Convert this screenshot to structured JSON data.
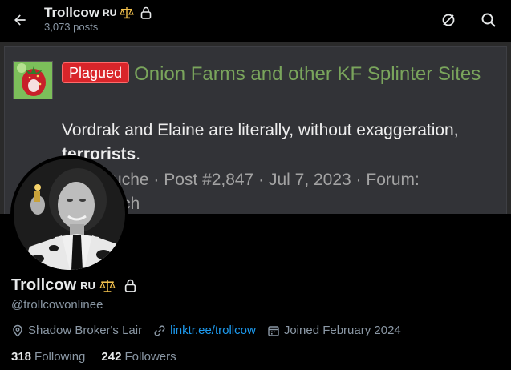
{
  "header": {
    "name": "Trollcow",
    "badge_text": "RU",
    "posts": "3,073 posts"
  },
  "banner": {
    "tag": "Plagued",
    "thread_title": "Onion Farms and other KF Splinter Sites",
    "quote_line1": "Vordrak and Elaine are literally, without exaggeration,",
    "quote_bold": "terrorists",
    "quote_end": ".",
    "meta_line1": "erryDouche · Post #2,847 · Jul 7, 2023 · Forum:",
    "meta_line2": "nity Watch"
  },
  "profile": {
    "name": "Trollcow",
    "badge_text": "RU",
    "handle": "@trollcowonlinee",
    "location": "Shadow Broker's Lair",
    "link": "linktr.ee/trollcow",
    "joined": "Joined February 2024",
    "following_count": "318",
    "following_label": "Following",
    "followers_count": "242",
    "followers_label": "Followers"
  },
  "icons": {
    "back": "arrow-left-icon",
    "scale": "scales-icon",
    "lock": "lock-icon",
    "grok": "grok-icon",
    "search": "search-icon",
    "location": "location-pin-icon",
    "link": "link-icon",
    "calendar": "calendar-icon"
  },
  "colors": {
    "background": "#000000",
    "accent": "#1d9bf0",
    "secondary_text": "#8b98a5",
    "thread_green": "#7aa55c",
    "tag_red": "#d9252a"
  }
}
